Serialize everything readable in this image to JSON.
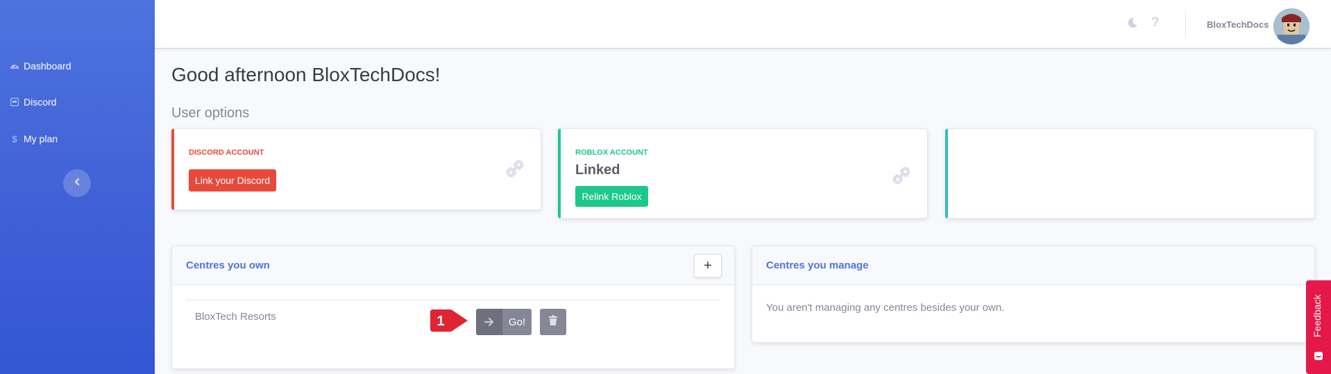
{
  "sidebar": {
    "items": [
      {
        "label": "Dashboard",
        "icon": "gauge-icon"
      },
      {
        "label": "Discord",
        "icon": "discord-icon"
      },
      {
        "label": "My plan",
        "icon": "dollar-icon"
      }
    ],
    "collapse_icon": "chevron-left-icon"
  },
  "topbar": {
    "username": "BloxTechDocs",
    "icons": [
      "moon-icon",
      "question-icon"
    ]
  },
  "main": {
    "greeting": "Good afternoon BloxTechDocs!",
    "section_title": "User options"
  },
  "cards": {
    "discord": {
      "label": "DISCORD ACCOUNT",
      "button": "Link your Discord",
      "accent": "#e74a3b"
    },
    "roblox": {
      "label": "ROBLOX ACCOUNT",
      "status": "Linked",
      "button": "Relink Roblox",
      "accent": "#1cc88a"
    },
    "blank": {
      "accent": "#36b9cc"
    }
  },
  "centres_own": {
    "title": "Centres you own",
    "add_label": "+",
    "rows": [
      {
        "name": "BloxTech Resorts",
        "go_label": "Go!"
      }
    ]
  },
  "centres_manage": {
    "title": "Centres you manage",
    "empty_text": "You aren't managing any centres besides your own."
  },
  "annotation": {
    "number": "1",
    "color": "#e02433"
  },
  "feedback": {
    "label": "Feedback",
    "color": "#e5184a"
  }
}
